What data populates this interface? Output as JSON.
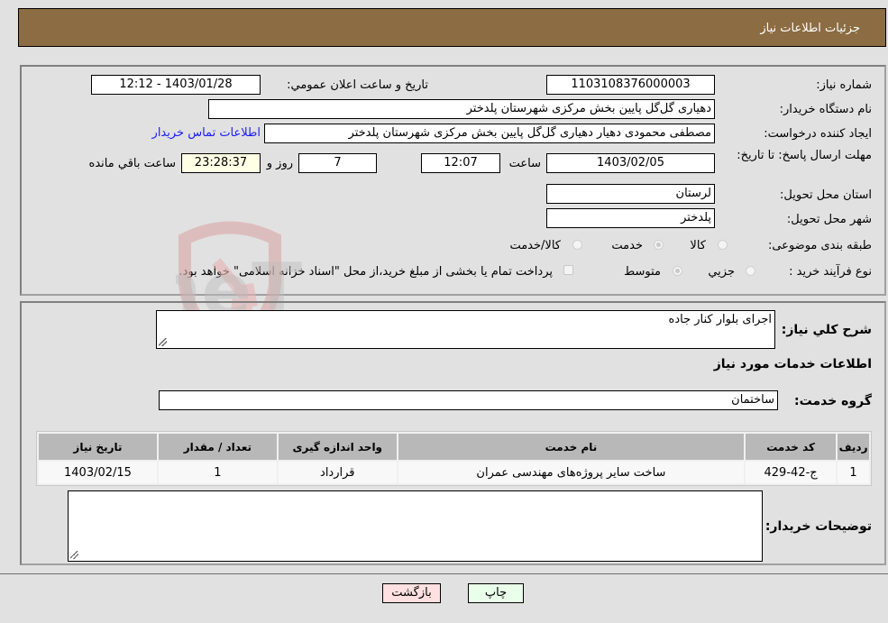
{
  "header": {
    "title": "جزئیات اطلاعات نیاز"
  },
  "details": {
    "need_number_label": "شماره نیاز:",
    "need_number": "1103108376000003",
    "announce_label": "تاریخ و ساعت اعلان عمومي:",
    "announce_value": "1403/01/28 - 12:12",
    "buyer_org_label": "نام دستگاه خریدار:",
    "buyer_org": "دهیاری گل‌گل پایین بخش مرکزی شهرستان پلدختر",
    "creator_label": "ایجاد کننده درخواست:",
    "creator": "مصطفی محمودی دهیار دهیاری گل‌گل پایین بخش مرکزی شهرستان پلدختر",
    "contact_link": "اطلاعات تماس خریدار",
    "deadline_label": "مهلت ارسال پاسخ: تا تاریخ:",
    "deadline_date": "1403/02/05",
    "time_label": "ساعت",
    "deadline_time": "12:07",
    "days_value": "7",
    "days_label": "روز و",
    "remaining_time": "23:28:37",
    "remaining_label": "ساعت باقي مانده",
    "province_label": "استان محل تحویل:",
    "province": "لرستان",
    "city_label": "شهر محل تحویل:",
    "city": "پلدختر",
    "category_label": "طبقه بندی موضوعی:",
    "category_options": [
      "کالا",
      "خدمت",
      "کالا/خدمت"
    ],
    "category_selected": "خدمت",
    "process_label": "نوع فرآیند خرید :",
    "process_options": [
      "جزيي",
      "متوسط"
    ],
    "process_selected": "متوسط",
    "treasury_note": "پرداخت تمام یا بخشی از مبلغ خرید،از محل \"اسناد خزانه اسلامی\" خواهد بود."
  },
  "summary": {
    "description_label": "شرح كلي نياز:",
    "description": "اجرای بلوار کنار جاده",
    "services_heading": "اطلاعات خدمات مورد نیاز",
    "service_group_label": "گروه خدمت:",
    "service_group": "ساختمان"
  },
  "table": {
    "headers": [
      "ردیف",
      "کد خدمت",
      "نام خدمت",
      "واحد اندازه گیری",
      "تعداد / مقدار",
      "تاریخ نیاز"
    ],
    "rows": [
      [
        "1",
        "ج-42-429",
        "ساخت سایر پروژه‌های مهندسی عمران",
        "قرارداد",
        "1",
        "1403/02/15"
      ]
    ]
  },
  "buyer_notes": {
    "label": "توضیحات خریدار:",
    "value": ""
  },
  "buttons": {
    "print": "چاپ",
    "back": "بازگشت"
  },
  "watermark": {
    "text": "AriaTender.neT"
  },
  "colors": {
    "header_bg": "#8c6c42",
    "print_bg": "#eaffea",
    "back_bg": "#ffe0e0",
    "link": "#1a1aff"
  }
}
